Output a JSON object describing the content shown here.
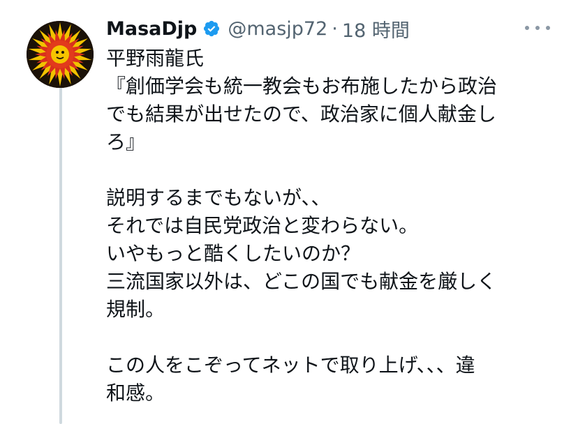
{
  "tweet": {
    "display_name": "MasaDjp",
    "handle": "@masjp72",
    "separator": "·",
    "timestamp": "18 時間",
    "verified_icon": "verified-badge-icon",
    "more_icon": "more-dots-icon",
    "lines": [
      "平野雨龍氏",
      "『創価学会も統一教会もお布施したから政治",
      "でも結果が出せたので、政治家に個人献金し",
      "ろ』",
      "",
      "説明するまでもないが、、",
      "それでは自民党政治と変わらない。",
      "いやもっと酷くしたいのか？",
      "三流国家以外は、どこの国でも献金を厳しく",
      "規制。",
      "",
      "この人をこぞってネットで取り上げ、、、違",
      "和感。"
    ]
  },
  "colors": {
    "text": "#0f1419",
    "secondary": "#536471",
    "verified_blue": "#1d9bf0",
    "thread_line": "#cfd9de"
  }
}
